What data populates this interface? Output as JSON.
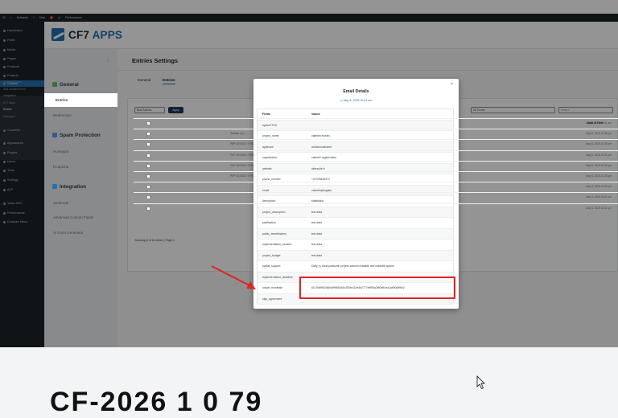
{
  "admin_bar": {
    "site": "Softands",
    "new": "New",
    "badge": "0",
    "performance": "Performance"
  },
  "sidebar": {
    "items": [
      {
        "label": "Dashboard"
      },
      {
        "label": "Posts"
      },
      {
        "label": "Media"
      },
      {
        "label": "Pages"
      },
      {
        "label": "Products"
      },
      {
        "label": "Projects"
      },
      {
        "label": "Contact"
      }
    ],
    "sub_items": [
      {
        "label": "Contact Forms"
      },
      {
        "label": "Add Contact Form"
      },
      {
        "label": "Integration"
      },
      {
        "label": "CF7 Apps"
      },
      {
        "label": "Entries"
      },
      {
        "label": "Honeypot"
      }
    ],
    "lower_items": [
      {
        "label": "Countries"
      },
      {
        "label": "Appearance"
      },
      {
        "label": "Plugins"
      },
      {
        "label": "Users"
      },
      {
        "label": "Tools"
      },
      {
        "label": "Settings"
      },
      {
        "label": "ACF"
      },
      {
        "label": "Yoast SEO"
      },
      {
        "label": "Performance"
      },
      {
        "label": "Collapse Menu"
      }
    ]
  },
  "brand": {
    "name_main": "CF7",
    "name_accent": "APPS"
  },
  "left_nav": {
    "collapse": "‹",
    "sections": [
      {
        "title": "General",
        "color": "#3a6e45",
        "links": [
          "Entries",
          "Redirection"
        ]
      },
      {
        "title": "Spam Protection",
        "color": "#2f5d8a",
        "links": [
          "Honeypot",
          "hCaptcha"
        ]
      },
      {
        "title": "Integration",
        "color": "#2271b1",
        "links": [
          "Webhook",
          "Advanced Custom Fields",
          "AI Form Generator"
        ]
      }
    ]
  },
  "page": {
    "title": "Entries Settings",
    "tabs": [
      "General",
      "Entries"
    ]
  },
  "toolbar": {
    "bulk_actions": "Bulk Actions",
    "apply": "Apply",
    "filter_select": "All Forms",
    "search_placeholder": "Search"
  },
  "background_table": {
    "date_header": "Date & Time",
    "rows": [
      {
        "snippet": "",
        "date": "May 6, 2025 09:41 am"
      },
      {
        "snippet": "Website dev...",
        "date": "May 5, 2025 10:05 pm"
      },
      {
        "snippet": "PHP DESIGN / PHP...",
        "date": "May 5, 2025 10:30 pm"
      },
      {
        "snippet": "PHP DESIGN / PHP...",
        "date": "May 5, 2025 10:22 pm"
      },
      {
        "snippet": "PHP DESIGN / PHP...",
        "date": "May 5, 2025 10:20 pm"
      },
      {
        "snippet": "PHP DESIGN / PHP...",
        "date": "May 5, 2025 10:20 pm"
      },
      {
        "snippet": "",
        "date": "May 4, 2025 10:00 pm"
      },
      {
        "snippet": "",
        "date": "May 4, 2025 10:01 pm"
      },
      {
        "snippet": "",
        "date": "May 4, 2025 10:02 pm"
      }
    ],
    "showing": "Showing 8 of 8 entries | Page 1"
  },
  "modal": {
    "close": "×",
    "title": "Email Details",
    "date": "May 6, 2025 09:41 am",
    "headers": {
      "field": "Fields",
      "value": "Values"
    },
    "rows": [
      {
        "field": "hyforcF7DO",
        "value": ""
      },
      {
        "field": "project_name",
        "value": "valentin moraru"
      },
      {
        "field": "applicant",
        "value": "antoinesuterame"
      },
      {
        "field": "organization",
        "value": "valentin organization"
      },
      {
        "field": "website",
        "value": "altersuite.fr"
      },
      {
        "field": "phone_number",
        "value": "+37378838374"
      },
      {
        "field": "email",
        "value": "valentin@logatio"
      },
      {
        "field": "description",
        "value": "blaablaba"
      },
      {
        "field": "project_description",
        "value": "test data"
      },
      {
        "field": "justification",
        "value": "test data"
      },
      {
        "field": "public_beneficiaries",
        "value": "test data"
      },
      {
        "field": "implementation_location",
        "value": "test data"
      },
      {
        "field": "project_budget",
        "value": "test data"
      },
      {
        "field": "partial_support",
        "value": "Daily_is 6dd4 partkumb projets sarkom readattb test readattb apiorel"
      },
      {
        "field": "implementation_deadline",
        "value": ""
      },
      {
        "field": "oracle_monitrate",
        "value": "61c7fa9f6f2d4b0df9f854b1b250fe410e4e2777ef596a2f60e84ea1ab90a5f6e2"
      },
      {
        "field": "sign_agreement",
        "value": ""
      }
    ]
  },
  "caption_fragment": "CF-2026 1 0 79"
}
